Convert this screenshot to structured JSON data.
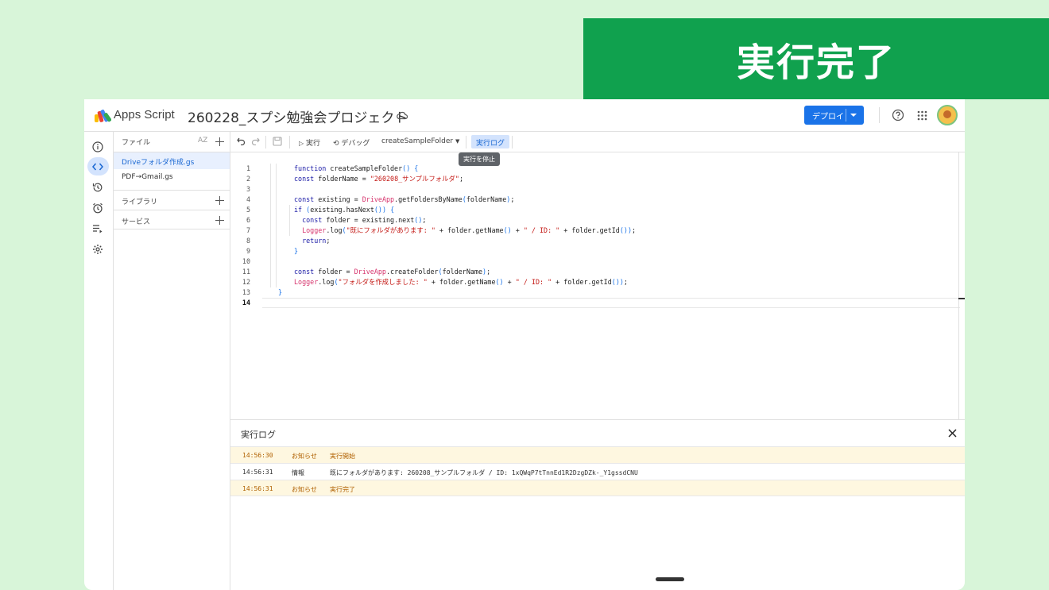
{
  "banner": {
    "text": "実行完了"
  },
  "app": {
    "name": "Apps Script",
    "project_title": "260228_スプシ勉強会プロジェクト"
  },
  "header": {
    "deploy_label": "デプロイ"
  },
  "colors": {
    "accent": "#1a73e8",
    "banner": "#10a14e",
    "background": "#d8f5d9",
    "notice_row": "#fef7e0"
  },
  "sidebar": {
    "icons": [
      "info-icon",
      "code-icon",
      "history-icon",
      "alarm-icon",
      "executions-icon",
      "settings-icon"
    ],
    "active": "code-icon"
  },
  "files_panel": {
    "header": "ファイル",
    "sort_label": "AZ",
    "files": [
      {
        "name": "Driveフォルダ作成.gs",
        "active": true
      },
      {
        "name": "PDF→Gmail.gs",
        "active": false
      }
    ],
    "libraries_label": "ライブラリ",
    "services_label": "サービス"
  },
  "toolbar": {
    "run_label": "実行",
    "debug_label": "デバッグ",
    "function_name": "createSampleFolder",
    "exec_log_label": "実行ログ",
    "tooltip": "実行を停止"
  },
  "editor": {
    "line_numbers": [
      "1",
      "2",
      "3",
      "4",
      "5",
      "6",
      "7",
      "8",
      "9",
      "10",
      "11",
      "12",
      "13",
      "14"
    ],
    "current_line": "14",
    "code_lines": [
      "function createSampleFolder() {",
      "const folderName = \"260208_サンプルフォルダ\";",
      "",
      "const existing = DriveApp.getFoldersByName(folderName);",
      "if (existing.hasNext()) {",
      "  const folder = existing.next();",
      "  Logger.log(\"既にフォルダがあります: \" + folder.getName() + \" / ID: \" + folder.getId());",
      "  return;",
      "}",
      "",
      "const folder = DriveApp.createFolder(folderName);",
      "Logger.log(\"フォルダを作成しました: \" + folder.getName() + \" / ID: \" + folder.getId());",
      "}",
      ""
    ]
  },
  "log_panel": {
    "title": "実行ログ",
    "rows": [
      {
        "time": "14:56:30",
        "level": "お知らせ",
        "message": "実行開始",
        "kind": "notice"
      },
      {
        "time": "14:56:31",
        "level": "情報",
        "message": "既にフォルダがあります: 260208_サンプルフォルダ / ID: 1xQWqP7tTnnEd1R2DzgDZk-_Y1gssdCNU",
        "kind": "info"
      },
      {
        "time": "14:56:31",
        "level": "お知らせ",
        "message": "実行完了",
        "kind": "notice"
      }
    ]
  }
}
